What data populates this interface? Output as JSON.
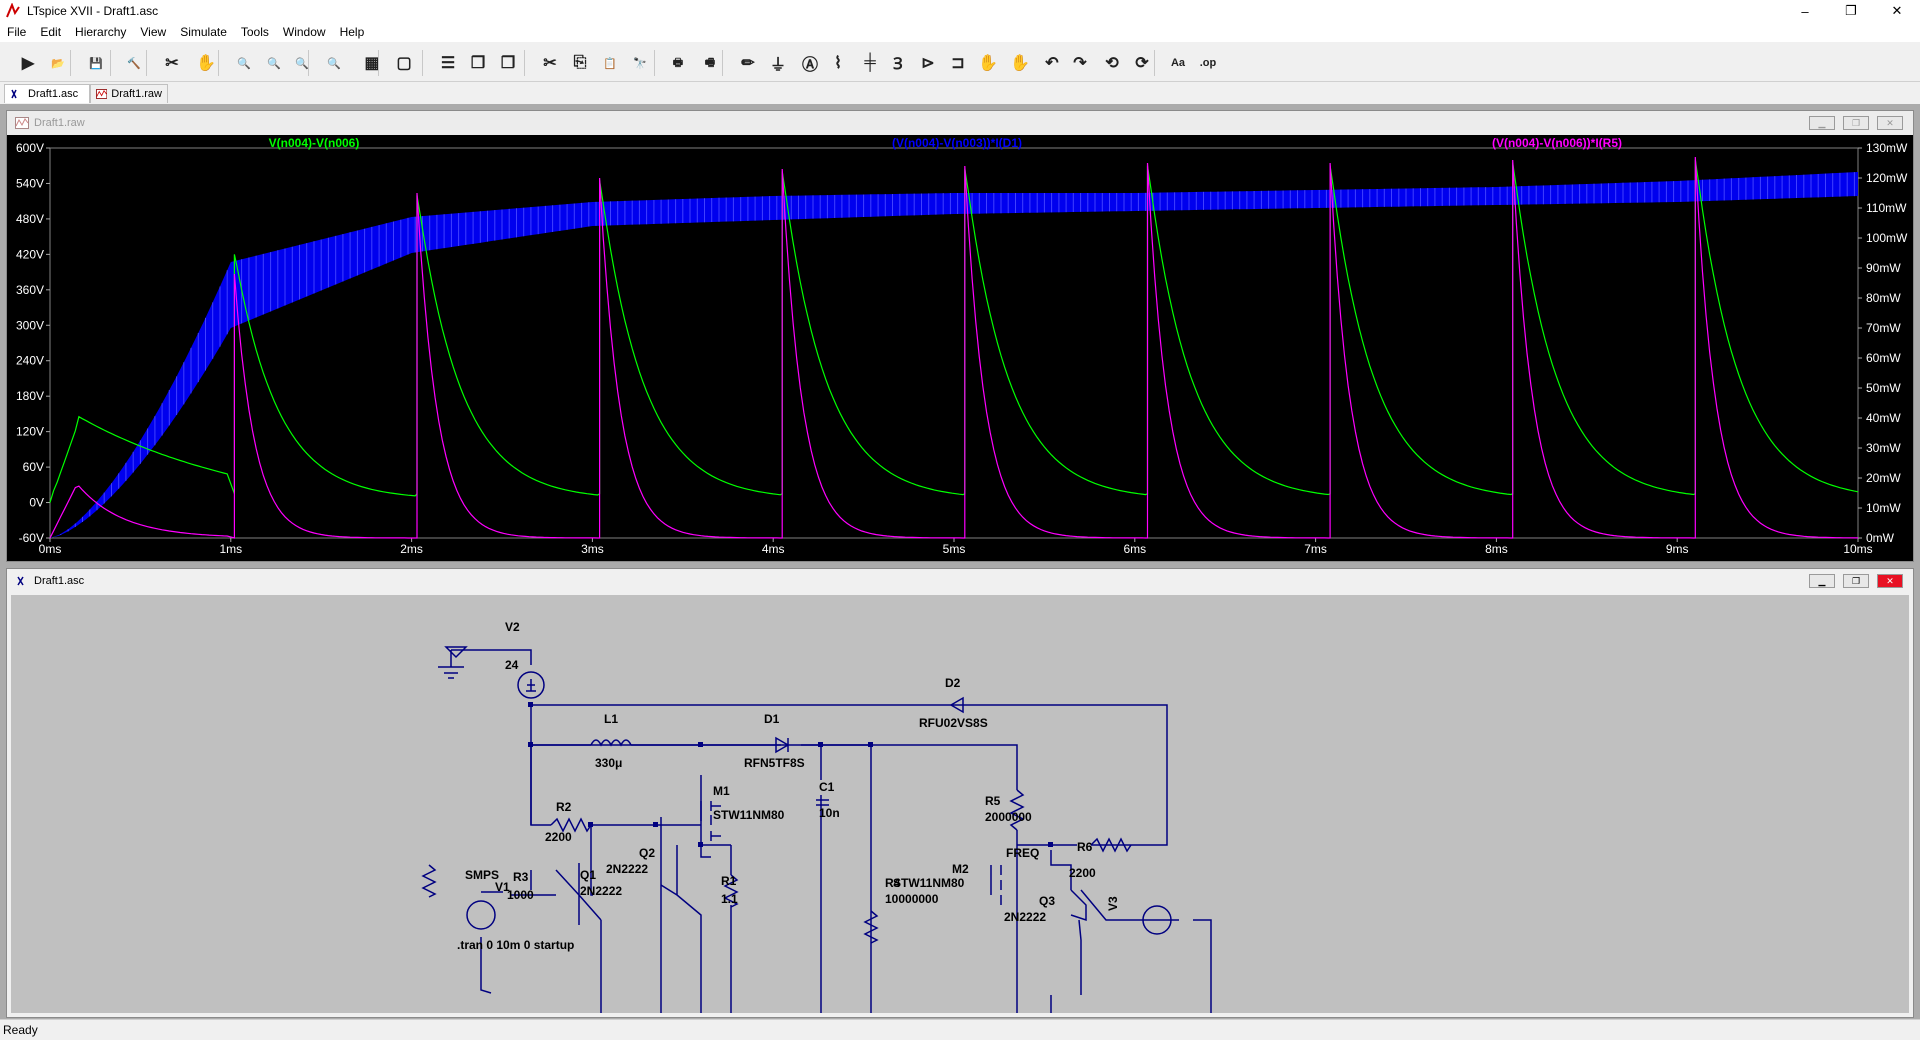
{
  "window": {
    "title": "LTspice XVII - Draft1.asc",
    "minimize": "–",
    "maximize": "❐",
    "close": "✕"
  },
  "menu": [
    "File",
    "Edit",
    "Hierarchy",
    "View",
    "Simulate",
    "Tools",
    "Window",
    "Help"
  ],
  "toolbar": {
    "tools": [
      {
        "name": "run-icon",
        "glyph": "▶"
      },
      {
        "name": "open-icon",
        "glyph": "📂"
      },
      {
        "name": "save-icon",
        "glyph": "💾"
      },
      {
        "name": "control-panel-icon",
        "glyph": "🔨"
      },
      {
        "name": "run-halt-icon",
        "glyph": "✂"
      },
      {
        "name": "pan-icon",
        "glyph": "✋"
      },
      {
        "name": "zoom-in-icon",
        "glyph": "🔍"
      },
      {
        "name": "zoom-pan-icon",
        "glyph": "🔍"
      },
      {
        "name": "zoom-out-icon",
        "glyph": "🔍"
      },
      {
        "name": "zoom-fit-icon",
        "glyph": "🔍"
      },
      {
        "name": "autorange-icon",
        "glyph": "▦"
      },
      {
        "name": "zoom-extents-icon",
        "glyph": "▢"
      },
      {
        "name": "tile-horizontal-icon",
        "glyph": "☰"
      },
      {
        "name": "cascade-icon",
        "glyph": "❒"
      },
      {
        "name": "tile-vertical-icon",
        "glyph": "❐"
      },
      {
        "name": "cut-icon",
        "glyph": "✂"
      },
      {
        "name": "copy-icon",
        "glyph": "⎘"
      },
      {
        "name": "paste-icon",
        "glyph": "📋"
      },
      {
        "name": "find-icon",
        "glyph": "🔭"
      },
      {
        "name": "print-icon",
        "glyph": "🖶"
      },
      {
        "name": "print-preview-icon",
        "glyph": "🖷"
      },
      {
        "name": "draw-wire-icon",
        "glyph": "✏"
      },
      {
        "name": "ground-icon",
        "glyph": "⏚"
      },
      {
        "name": "label-net-icon",
        "glyph": "Ⓐ"
      },
      {
        "name": "resistor-icon",
        "glyph": "⌇"
      },
      {
        "name": "capacitor-icon",
        "glyph": "╪"
      },
      {
        "name": "inductor-icon",
        "glyph": "Ɜ"
      },
      {
        "name": "diode-icon",
        "glyph": "⊳"
      },
      {
        "name": "component-icon",
        "glyph": "⊐"
      },
      {
        "name": "move-icon",
        "glyph": "✋"
      },
      {
        "name": "drag-icon",
        "glyph": "✋"
      },
      {
        "name": "undo-icon",
        "glyph": "↶"
      },
      {
        "name": "redo-icon",
        "glyph": "↷"
      },
      {
        "name": "rotate-icon",
        "glyph": "⟲"
      },
      {
        "name": "mirror-icon",
        "glyph": "⟳"
      },
      {
        "name": "text-icon",
        "glyph": "Aa"
      },
      {
        "name": "spice-directive-icon",
        "glyph": ".op"
      }
    ]
  },
  "tabs": [
    {
      "label": "Draft1.asc",
      "active": true
    },
    {
      "label": "Draft1.raw",
      "active": false
    }
  ],
  "waveform_window": {
    "title": "Draft1.raw",
    "traces": [
      {
        "label": "V(n004)-V(n006)",
        "color": "#00ff00"
      },
      {
        "label": "(V(n004)-V(n003))*I(D1)",
        "color": "#0000ff"
      },
      {
        "label": "(V(n004)-V(n006))*I(R5)",
        "color": "#ff00ff"
      }
    ]
  },
  "chart_data": {
    "type": "line",
    "x": [
      0,
      1,
      2,
      3,
      4,
      5,
      6,
      7,
      8,
      9,
      10
    ],
    "x_tick_labels": [
      "0ms",
      "1ms",
      "2ms",
      "3ms",
      "4ms",
      "5ms",
      "6ms",
      "7ms",
      "8ms",
      "9ms",
      "10ms"
    ],
    "xlim": [
      0,
      10
    ],
    "y_left_ticks": [
      "600V",
      "540V",
      "480V",
      "420V",
      "360V",
      "300V",
      "240V",
      "180V",
      "120V",
      "60V",
      "0V",
      "-60V"
    ],
    "ylim_left": [
      -60,
      600
    ],
    "y_right_ticks": [
      "130mW",
      "120mW",
      "110mW",
      "100mW",
      "90mW",
      "80mW",
      "70mW",
      "60mW",
      "50mW",
      "40mW",
      "30mW",
      "20mW",
      "10mW",
      "0mW"
    ],
    "ylim_right": [
      0,
      130
    ],
    "pulse_times_ms": [
      1.02,
      2.03,
      3.04,
      4.05,
      5.06,
      6.07,
      7.08,
      8.09,
      9.1
    ],
    "pulse_peaks_V": [
      420,
      520,
      545,
      560,
      565,
      570,
      570,
      575,
      580
    ],
    "series": [
      {
        "name": "V(n004)-V(n006)",
        "axis": "left",
        "color": "#00ff00",
        "start_peak_V": 130,
        "settle_V": 0
      },
      {
        "name": "(V(n004)-V(n003))*I(D1)",
        "axis": "right",
        "color": "#0000ff",
        "band_low_mW": [
          0,
          70,
          95,
          104,
          106,
          108,
          109,
          110,
          111,
          112,
          114
        ],
        "band_high_mW": [
          0,
          92,
          107,
          112,
          114,
          115,
          115,
          116,
          117,
          119,
          122
        ]
      },
      {
        "name": "(V(n004)-V(n006))*I(R5)",
        "axis": "right",
        "color": "#ff00ff",
        "pulse_peaks_mW": [
          88,
          115,
          120,
          123,
          124,
          125,
          125,
          126,
          127
        ]
      }
    ],
    "grid": false,
    "background": "#000000"
  },
  "schematic_window": {
    "title": "Draft1.asc",
    "labels": {
      "V2": "V2",
      "V2val": "24",
      "L1": "L1",
      "L1val": "330μ",
      "D1": "D1",
      "D1val": "RFN5TF8S",
      "D2": "D2",
      "D2val": "RFU02VS8S",
      "M1": "M1",
      "M1val": "STW11NM80",
      "C1": "C1",
      "C1val": "10n",
      "R5": "R5",
      "R5val": "2000000",
      "R2": "R2",
      "R2val": "2200",
      "Q2": "Q2",
      "Q2val": "2N2222",
      "R1": "R1",
      "R1val": "1.1",
      "R3": "R3",
      "R3val": "1000",
      "Q1": "Q1",
      "Q1val": "2N2222",
      "SMPS": "SMPS",
      "V1": "V1",
      "M2": "M2",
      "M2val": "STW11NM80",
      "R4": "R4",
      "R4val": "10000000",
      "FREQ": "FREQ",
      "R6": "R6",
      "R6val": "2200",
      "Q3": "Q3",
      "Q3val": "2N2222",
      "V3": "V3",
      "directive": ".tran 0 10m 0 startup"
    }
  },
  "status": "Ready",
  "colors": {
    "wire": "#000080",
    "schematic_bg": "#c0c0c0",
    "plot_bg": "#000000"
  }
}
